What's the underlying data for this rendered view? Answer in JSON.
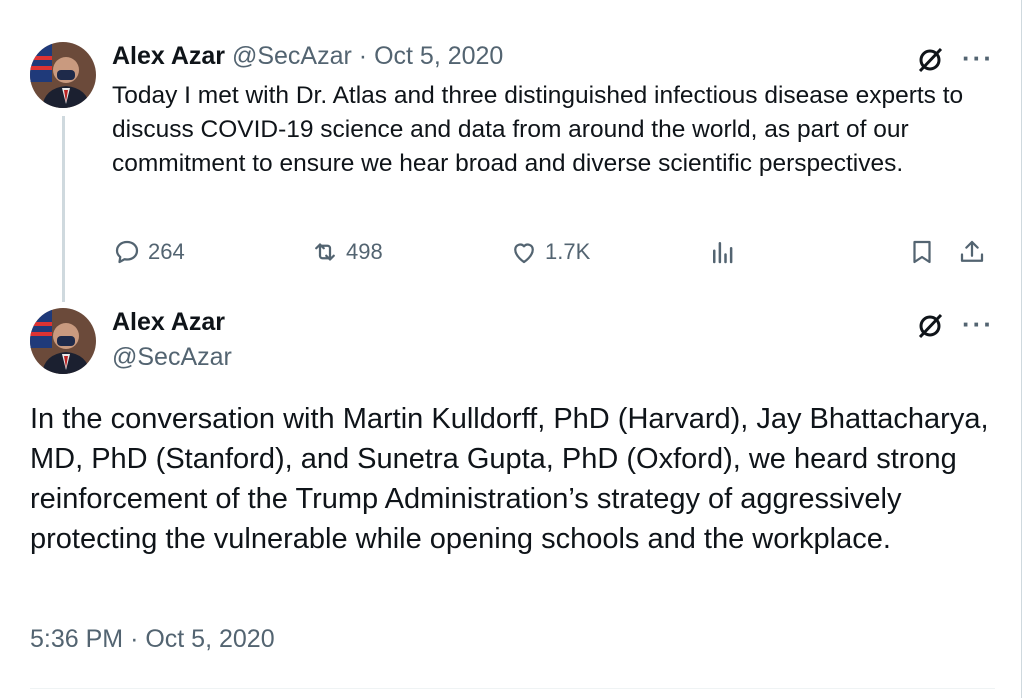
{
  "tweet1": {
    "author_name": "Alex Azar",
    "handle": "@SecAzar",
    "separator": "·",
    "date": "Oct 5, 2020",
    "text": "Today I met with Dr. Atlas and three distinguished infectious disease experts to discuss COVID-19 science and data from around the world, as part of our commitment to ensure we hear broad and diverse scientific perspectives.",
    "replies": "264",
    "retweets": "498",
    "likes": "1.7K"
  },
  "tweet2": {
    "author_name": "Alex Azar",
    "handle": "@SecAzar",
    "text": "In the conversation with Martin Kulldorff, PhD (Harvard), Jay Bhattacharya, MD, PhD (Stanford), and Sunetra Gupta, PhD (Oxford), we heard strong reinforcement of the Trump Administration’s strategy of aggressively protecting the vulnerable while opening schools and the workplace.",
    "time": "5:36 PM",
    "separator": "·",
    "date": "Oct 5, 2020"
  },
  "icons": [
    "avatar",
    "grok-slash-icon",
    "more-icon",
    "reply-icon",
    "retweet-icon",
    "like-icon",
    "views-icon",
    "bookmark-icon",
    "share-icon"
  ],
  "colors": {
    "text": "#0f1419",
    "muted": "#536471",
    "border": "#cfd9de"
  }
}
